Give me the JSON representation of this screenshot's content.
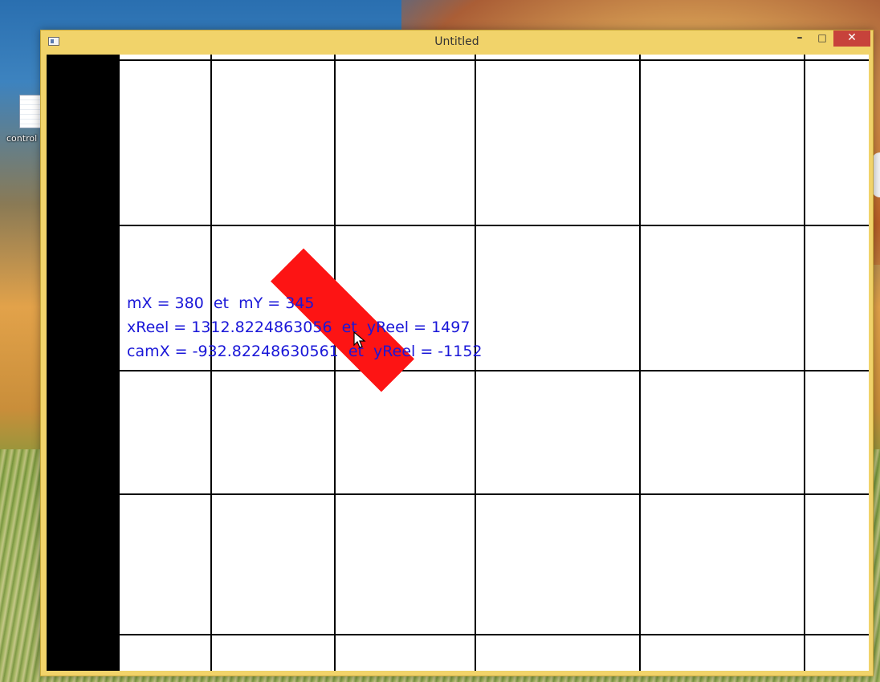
{
  "desktop": {
    "icon_label": "control",
    "icon_name": "text-file-icon"
  },
  "window": {
    "title": "Untitled",
    "system_icon": "app-window-icon",
    "buttons": {
      "minimize": "–",
      "maximize": "□",
      "close": "✕"
    },
    "accent_color": "#f1d36a",
    "close_color": "#c7423b"
  },
  "canvas": {
    "background_color": "#ffffff",
    "sidebar_color": "#000000",
    "shape_color": "#fd1414",
    "text_color": "#1a17d8",
    "info_lines": [
      "mX = 380  et  mY = 345",
      "xReel = 1312.8224863056  et  yReel = 1497",
      "camX = -932.82248630561  et  yReel = -1152"
    ]
  }
}
